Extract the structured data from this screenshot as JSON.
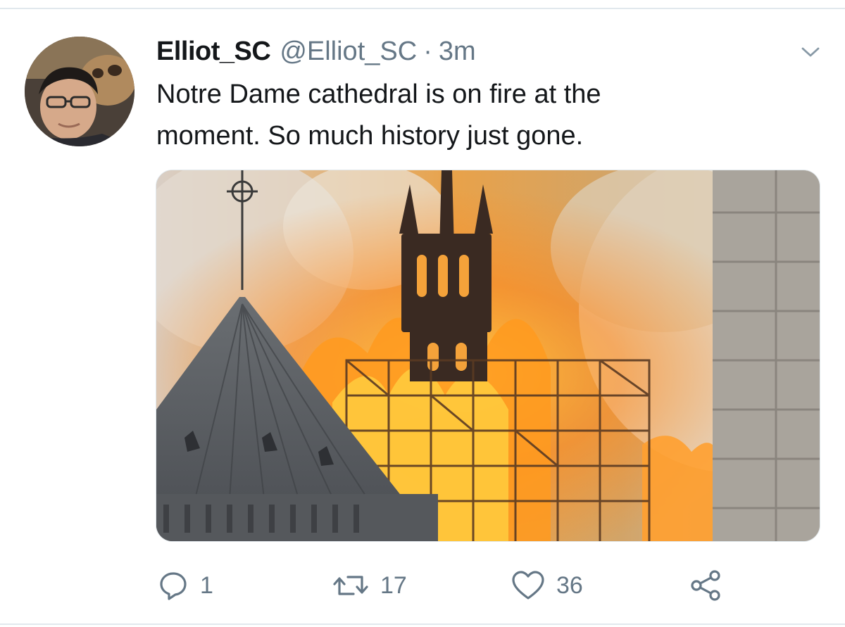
{
  "tweet": {
    "display_name": "Elliot_SC",
    "handle": "@Elliot_SC",
    "separator": "·",
    "time": "3m",
    "text_lines": [
      "Notre Dame cathedral is on fire at the",
      "moment. So much history just gone."
    ]
  },
  "media": {
    "subject": "Notre Dame cathedral spire and roof on fire with scaffolding and smoke"
  },
  "actions": {
    "reply_count": "1",
    "retweet_count": "17",
    "like_count": "36"
  },
  "icons": {
    "menu": "chevron-down-icon",
    "reply": "reply-icon",
    "retweet": "retweet-icon",
    "like": "heart-icon",
    "share": "share-icon"
  },
  "colors": {
    "text": "#14171a",
    "secondary": "#657786",
    "divider": "#e1e8ed"
  }
}
